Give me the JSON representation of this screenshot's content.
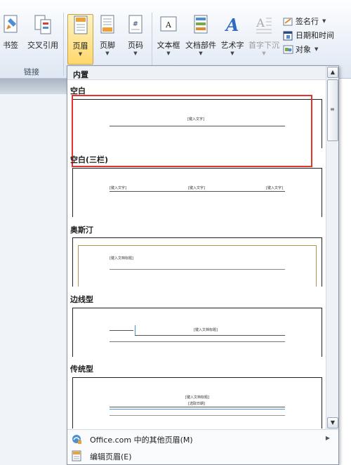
{
  "ribbon": {
    "links_group": {
      "bookmark": "书签",
      "cross_ref": "交叉引用",
      "label": "链接"
    },
    "header_footer": {
      "header": "页眉",
      "footer": "页脚",
      "page_number": "页码"
    },
    "text_group": {
      "textbox": "文本框",
      "quick_parts": "文档部件",
      "wordart": "艺术字",
      "dropcap": "首字下沉",
      "signature_line": "签名行",
      "date_time": "日期和时间",
      "object": "对象"
    }
  },
  "gallery": {
    "heading": "内置",
    "sections": [
      {
        "title": "空白",
        "placeholders": [
          "[键入文字]"
        ]
      },
      {
        "title": "空白(三栏)",
        "placeholders": [
          "[键入文字]",
          "[键入文字]",
          "[键入文字]"
        ]
      },
      {
        "title": "奥斯汀",
        "placeholders": [
          "[键入文档标题]"
        ]
      },
      {
        "title": "边线型",
        "placeholders": [
          "[键入文档标题]"
        ]
      },
      {
        "title": "传统型",
        "placeholders": [
          "[键入文档标题]",
          "[选取日期]"
        ]
      }
    ],
    "menu": {
      "more_headers": "Office.com 中的其他页眉(M)",
      "edit_header": "编辑页眉(E)"
    }
  },
  "colors": {
    "selection_outline": "#e2332f",
    "active_button": "#ffd86b"
  }
}
